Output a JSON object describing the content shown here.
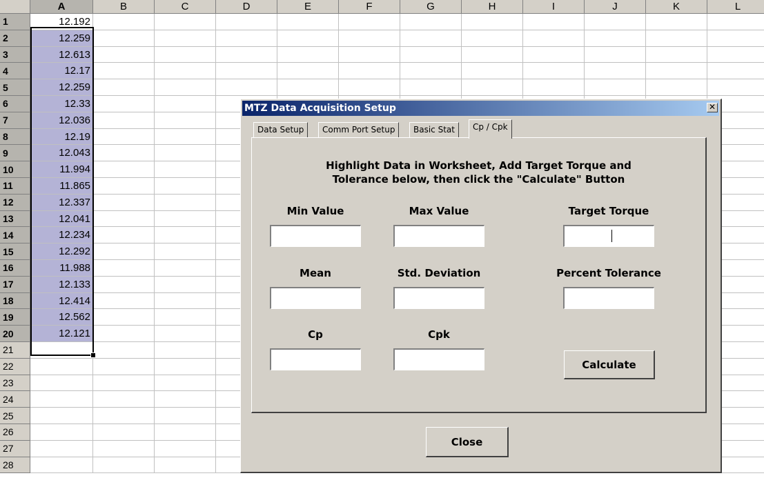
{
  "sheet": {
    "columns": [
      "A",
      "B",
      "C",
      "D",
      "E",
      "F",
      "G",
      "H",
      "I",
      "J",
      "K",
      "L"
    ],
    "rows": [
      "1",
      "2",
      "3",
      "4",
      "5",
      "6",
      "7",
      "8",
      "9",
      "10",
      "11",
      "12",
      "13",
      "14",
      "15",
      "16",
      "17",
      "18",
      "19",
      "20",
      "21",
      "22",
      "23",
      "24",
      "25",
      "26",
      "27",
      "28"
    ],
    "columnA": [
      "12.192",
      "12.259",
      "12.613",
      "12.17",
      "12.259",
      "12.33",
      "12.036",
      "12.19",
      "12.043",
      "11.994",
      "11.865",
      "12.337",
      "12.041",
      "12.234",
      "12.292",
      "11.988",
      "12.133",
      "12.414",
      "12.562",
      "12.121"
    ],
    "selection_color": "#b4b3d6"
  },
  "dialog": {
    "title": "MTZ Data Acquisition Setup",
    "close_glyph": "✕",
    "tabs": [
      "Data Setup",
      "Comm Port Setup",
      "Basic Stat",
      "Cp / Cpk"
    ],
    "active_tab": "Cp / Cpk",
    "instructions_line1": "Highlight Data in Worksheet, Add Target Torque and",
    "instructions_line2": "Tolerance below, then click the \"Calculate\" Button",
    "labels": {
      "min_value": "Min Value",
      "max_value": "Max Value",
      "target_torque": "Target Torque",
      "mean": "Mean",
      "std_deviation": "Std. Deviation",
      "percent_tolerance": "Percent Tolerance",
      "cp": "Cp",
      "cpk": "Cpk"
    },
    "values": {
      "min_value": "",
      "max_value": "",
      "target_torque": "",
      "mean": "",
      "std_deviation": "",
      "percent_tolerance": "",
      "cp": "",
      "cpk": ""
    },
    "calculate_label": "Calculate",
    "close_label": "Close",
    "titlebar_color": "#0a246a"
  }
}
